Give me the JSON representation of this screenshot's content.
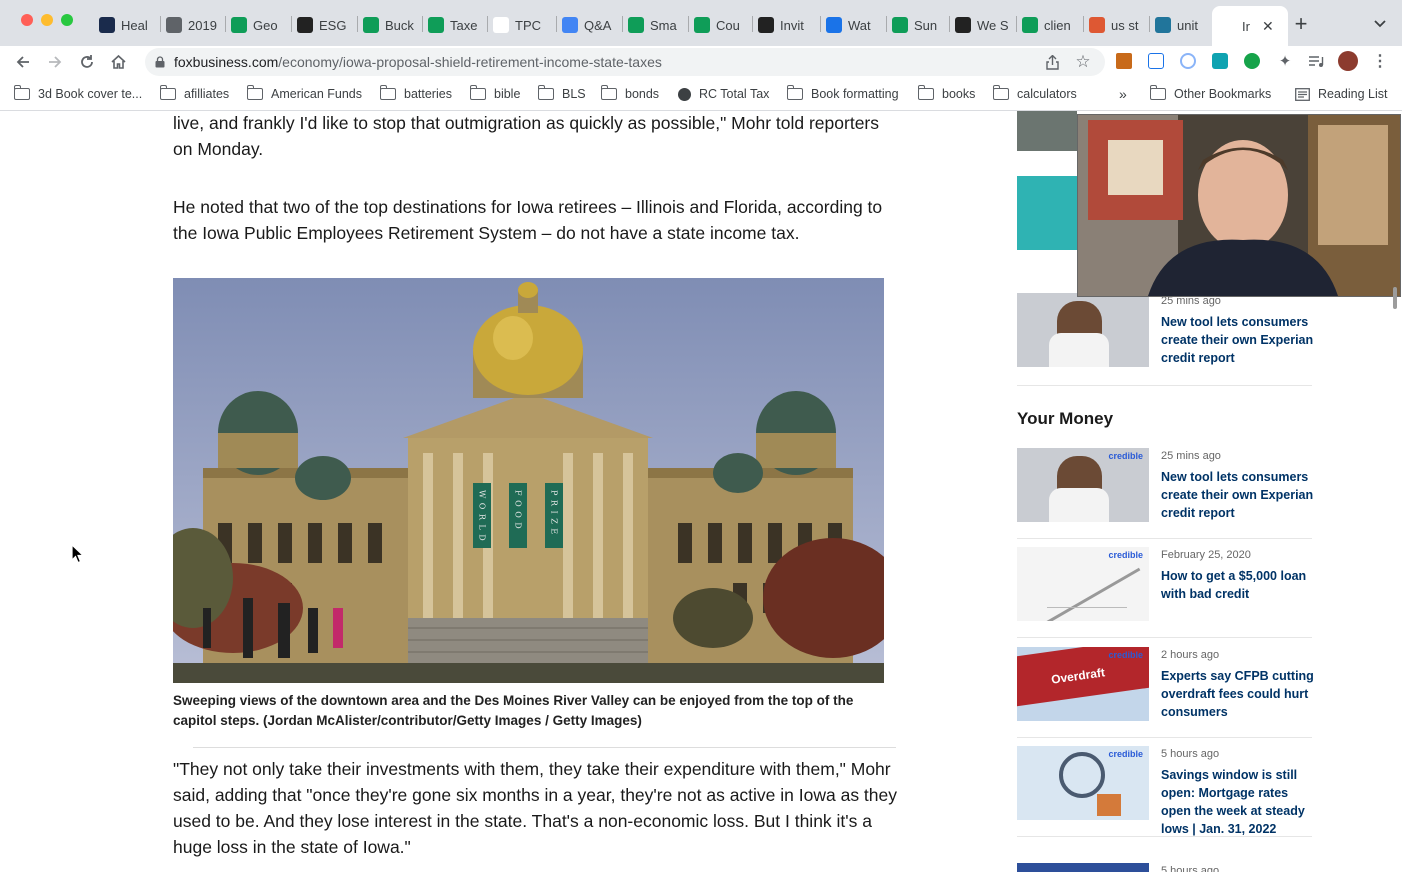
{
  "colors": {
    "link_blue": "#003366",
    "tabbar_bg": "#dee1e6"
  },
  "tabs": [
    {
      "label": "Heal",
      "icon": "hc-icon",
      "color": "#1a2b4c"
    },
    {
      "label": "2019",
      "icon": "globe-icon",
      "color": "#5f6368"
    },
    {
      "label": "Geo",
      "icon": "sheets-plus-icon",
      "color": "#0f9d58"
    },
    {
      "label": "ESG",
      "icon": "wsj-icon",
      "color": "#222222"
    },
    {
      "label": "Buck",
      "icon": "sheets-plus-icon",
      "color": "#0f9d58"
    },
    {
      "label": "Taxe",
      "icon": "sheets-plus-icon",
      "color": "#0f9d58"
    },
    {
      "label": "TPC",
      "icon": "tpc-icon",
      "color": "#ffffff"
    },
    {
      "label": "Q&A",
      "icon": "docs-icon",
      "color": "#4285f4"
    },
    {
      "label": "Sma",
      "icon": "sheets-plus-icon",
      "color": "#0f9d58"
    },
    {
      "label": "Cou",
      "icon": "sheets-plus-icon",
      "color": "#0f9d58"
    },
    {
      "label": "Invit",
      "icon": "vimeo-icon",
      "color": "#222222"
    },
    {
      "label": "Wat",
      "icon": "play-icon",
      "color": "#1a73e8"
    },
    {
      "label": "Sun",
      "icon": "sheets-plus-icon",
      "color": "#0f9d58"
    },
    {
      "label": "We S",
      "icon": "wsj-icon",
      "color": "#222222"
    },
    {
      "label": "clien",
      "icon": "sheets-plus-icon",
      "color": "#0f9d58"
    },
    {
      "label": "us st",
      "icon": "duckduckgo-icon",
      "color": "#de5833"
    },
    {
      "label": "unit",
      "icon": "wordpress-icon",
      "color": "#21759b"
    },
    {
      "label": "Ir",
      "icon": "foxbusiness-icon",
      "color": "#ffffff"
    }
  ],
  "toolbar": {
    "url_domain": "foxbusiness.com",
    "url_path": "/economy/iowa-proposal-shield-retirement-income-state-taxes"
  },
  "bookmarks": [
    {
      "label": "3d Book cover te..."
    },
    {
      "label": "afilliates"
    },
    {
      "label": "American Funds"
    },
    {
      "label": "batteries"
    },
    {
      "label": "bible"
    },
    {
      "label": "BLS"
    },
    {
      "label": "bonds"
    },
    {
      "label": "RC Total Tax"
    },
    {
      "label": "Book formatting"
    },
    {
      "label": "books"
    },
    {
      "label": "calculators"
    }
  ],
  "bookmarks_more": "»",
  "other_bookmarks": "Other Bookmarks",
  "reading_list": "Reading List",
  "article": {
    "para1": "live, and frankly I'd like to stop that outmigration as quickly as possible,\" Mohr told reporters on Monday.",
    "para2": "He noted that two of the top destinations for Iowa retirees – Illinois and Florida, according to the Iowa Public Employees Retirement System – do not have a state income tax.",
    "banner_letters": [
      "W O R L D",
      "F O O D",
      "P R I Z E"
    ],
    "caption": "Sweeping views of the downtown area and the Des Moines River Valley can be enjoyed from the top of the capitol steps. (Jordan McAlister/contributor/Getty Images / Getty Images)",
    "para3": "\"They not only take their investments with them, they take their expenditure with them,\" Mohr said, adding that \"once they're gone six months in a year, they're not as active in Iowa as they used to be. And they lose interest in the state. That's a non-economic loss. But I think it's a huge loss in the state of Iowa.\""
  },
  "sidebar": {
    "top_card": {
      "time": "25 mins ago",
      "headline": "New tool lets consumers create their own Experian credit report"
    },
    "section_title": "Your Money",
    "cards": [
      {
        "time": "25 mins ago",
        "headline": "New tool lets consumers create their own Experian credit report",
        "thumb": "woman-phone"
      },
      {
        "time": "February 25, 2020",
        "headline": "How to get a $5,000 loan with bad credit",
        "thumb": "pen"
      },
      {
        "time": "2 hours ago",
        "headline": "Experts say CFPB cutting overdraft fees could hurt consumers",
        "thumb": "overdraft",
        "thumb_word": "Overdraft"
      },
      {
        "time": "5 hours ago",
        "headline": "Savings window is still open: Mortgage rates open the week at steady lows | Jan. 31, 2022",
        "thumb": "magnifier"
      },
      {
        "time": "5 hours ago",
        "headline": "",
        "thumb": "blue"
      }
    ],
    "thumb_brand": "credible"
  }
}
